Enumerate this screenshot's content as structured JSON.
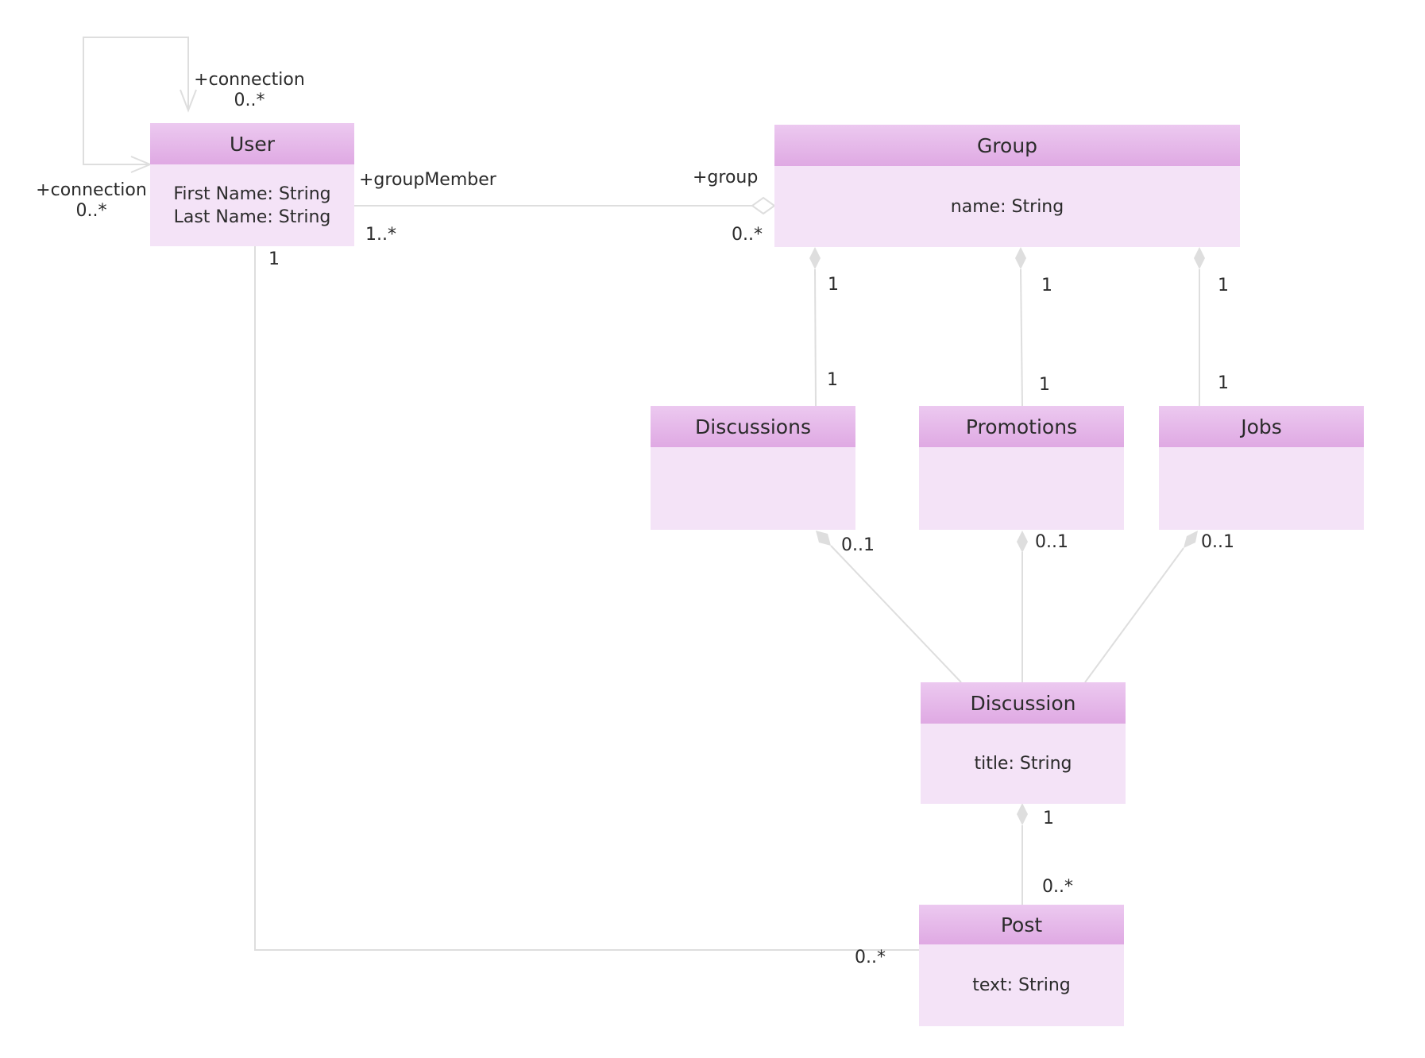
{
  "diagram": {
    "type": "UML class diagram",
    "colors": {
      "header_top": "#ecc9f0",
      "header_bottom": "#dfa9e3",
      "body": "#f4e3f7",
      "connector": "#dedede",
      "text": "#2b2b2b"
    },
    "classes": {
      "user": {
        "name": "User",
        "attributes": [
          "First Name: String",
          "Last Name: String"
        ]
      },
      "group": {
        "name": "Group",
        "attributes": [
          "name: String"
        ]
      },
      "discussions": {
        "name": "Discussions",
        "attributes": []
      },
      "promotions": {
        "name": "Promotions",
        "attributes": []
      },
      "jobs": {
        "name": "Jobs",
        "attributes": []
      },
      "discussion": {
        "name": "Discussion",
        "attributes": [
          "title: String"
        ]
      },
      "post": {
        "name": "Post",
        "attributes": [
          "text: String"
        ]
      }
    },
    "associations": {
      "self_connection": {
        "from": "User",
        "to": "User",
        "kind": "directed association",
        "end_a_role": "+connection",
        "end_a_multiplicity": "0..*",
        "end_b_role": "+connection",
        "end_b_multiplicity": "0..*"
      },
      "user_group": {
        "from": "User",
        "to": "Group",
        "kind": "aggregation",
        "user_role": "+groupMember",
        "user_multiplicity": "1..*",
        "group_role": "+group",
        "group_multiplicity": "0..*"
      },
      "group_discussions": {
        "kind": "composition",
        "whole": "Group",
        "part": "Discussions",
        "whole_multiplicity": "1",
        "part_multiplicity": "1"
      },
      "group_promotions": {
        "kind": "composition",
        "whole": "Group",
        "part": "Promotions",
        "whole_multiplicity": "1",
        "part_multiplicity": "1"
      },
      "group_jobs": {
        "kind": "composition",
        "whole": "Group",
        "part": "Jobs",
        "whole_multiplicity": "1",
        "part_multiplicity": "1"
      },
      "discussions_discussion": {
        "kind": "composition",
        "whole": "Discussions",
        "part": "Discussion",
        "whole_multiplicity": "0..1"
      },
      "promotions_discussion": {
        "kind": "composition",
        "whole": "Promotions",
        "part": "Discussion",
        "whole_multiplicity": "0..1"
      },
      "jobs_discussion": {
        "kind": "composition",
        "whole": "Jobs",
        "part": "Discussion",
        "whole_multiplicity": "0..1"
      },
      "discussion_post": {
        "kind": "composition",
        "whole": "Discussion",
        "part": "Post",
        "whole_multiplicity": "1",
        "part_multiplicity": "0..*"
      },
      "user_post": {
        "kind": "association",
        "from": "User",
        "to": "Post",
        "user_multiplicity": "1",
        "post_multiplicity": "0..*"
      }
    }
  }
}
